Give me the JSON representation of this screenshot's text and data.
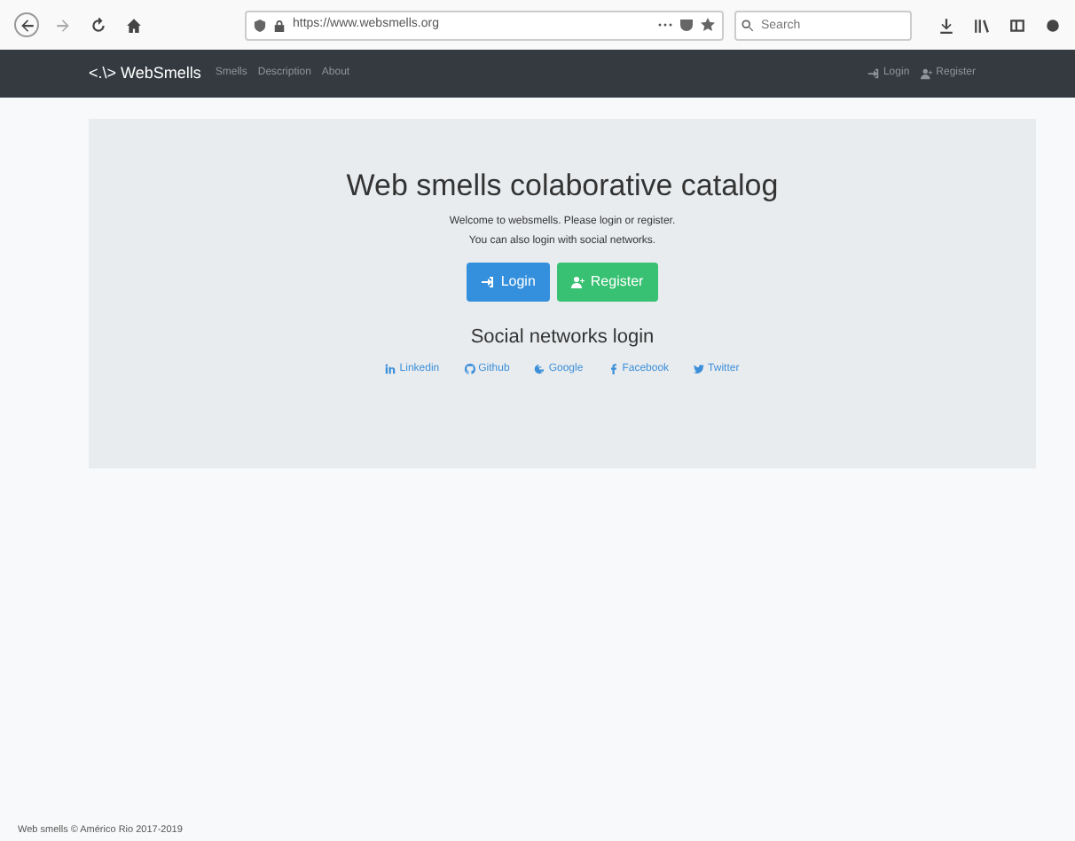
{
  "browser": {
    "url": "https://www.websmells.org",
    "search": {
      "placeholder": "Search"
    }
  },
  "navbar": {
    "brand": "<.\\> WebSmells",
    "links": [
      "Smells",
      "Description",
      "About"
    ],
    "right_links": [
      {
        "kind": "login",
        "label": "Login"
      },
      {
        "kind": "register",
        "label": "Register"
      }
    ]
  },
  "jumbotron": {
    "title": "Web smells colaborative catalog",
    "lines": [
      "Welcome to websmells. Please login or register.",
      "You can also login with social networks."
    ],
    "buttons": [
      {
        "kind": "login",
        "label": "Login"
      },
      {
        "kind": "register",
        "label": "Register"
      }
    ],
    "social_title": "Social networks login",
    "social_links": [
      {
        "kind": "linkedin",
        "label": "Linkedin"
      },
      {
        "kind": "github",
        "label": "Github"
      },
      {
        "kind": "google",
        "label": "Google"
      },
      {
        "kind": "facebook",
        "label": "Facebook"
      },
      {
        "kind": "twitter",
        "label": "Twitter"
      }
    ]
  },
  "footer": "Web smells © Américo Rio 2017-2019"
}
